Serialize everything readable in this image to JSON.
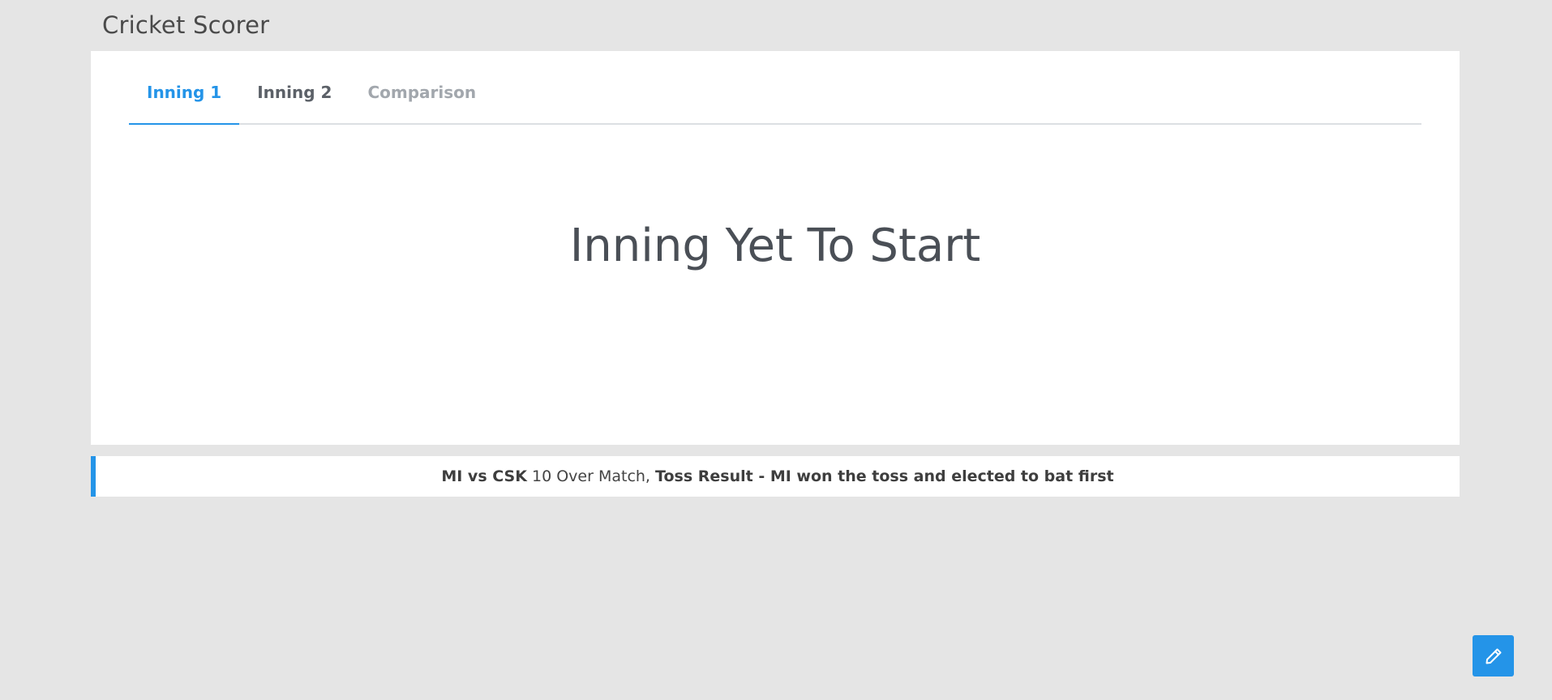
{
  "app": {
    "title": "Cricket Scorer"
  },
  "tabs": [
    {
      "label": "Inning 1",
      "state": "active"
    },
    {
      "label": "Inning 2",
      "state": "normal"
    },
    {
      "label": "Comparison",
      "state": "muted"
    }
  ],
  "main": {
    "message": "Inning Yet To Start"
  },
  "match_info": {
    "teams": "MI vs CSK",
    "format": "10 Over Match,",
    "toss": "Toss Result - MI won the toss and elected to bat first"
  },
  "fab": {
    "icon": "pencil-icon"
  },
  "colors": {
    "accent": "#2494e8",
    "background": "#e5e5e5",
    "card": "#ffffff"
  }
}
